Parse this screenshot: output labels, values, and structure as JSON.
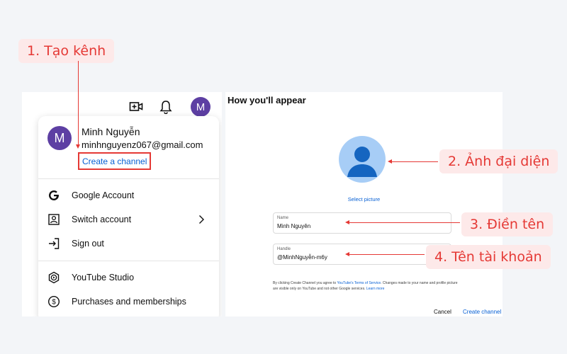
{
  "annotations": {
    "step1": "1. Tạo kênh",
    "step2": "2. Ảnh đại diện",
    "step3": "3. Điền tên",
    "step4": "4. Tên tài khoản",
    "color": "#e53935"
  },
  "account_menu": {
    "avatar_initial": "M",
    "user_name": "Minh Nguyễn",
    "user_email": "minhnguyenz067@gmail.com",
    "create_channel": "Create a channel",
    "items": [
      {
        "label": "Google Account",
        "icon": "google-icon"
      },
      {
        "label": "Switch account",
        "icon": "switch-account-icon"
      },
      {
        "label": "Sign out",
        "icon": "sign-out-icon"
      },
      {
        "label": "YouTube Studio",
        "icon": "youtube-studio-icon"
      },
      {
        "label": "Purchases and memberships",
        "icon": "dollar-icon"
      }
    ],
    "avatar_color": "#5d3fa3"
  },
  "channel_setup": {
    "title": "How you'll appear",
    "select_picture": "Select picture",
    "name_label": "Name",
    "name_value": "Minh Nguyên",
    "handle_label": "Handle",
    "handle_value": "@MinhNguyễn-m6y",
    "disclaimer_1": "By clicking Create Channel you agree to ",
    "disclaimer_link": "YouTube's Terms of Service",
    "disclaimer_2": ". Changes made to your name and profile picture are visible only on YouTube and not other Google services. ",
    "disclaimer_learn": "Learn more",
    "cancel": "Cancel",
    "create": "Create channel",
    "link_color": "#065fd4"
  }
}
